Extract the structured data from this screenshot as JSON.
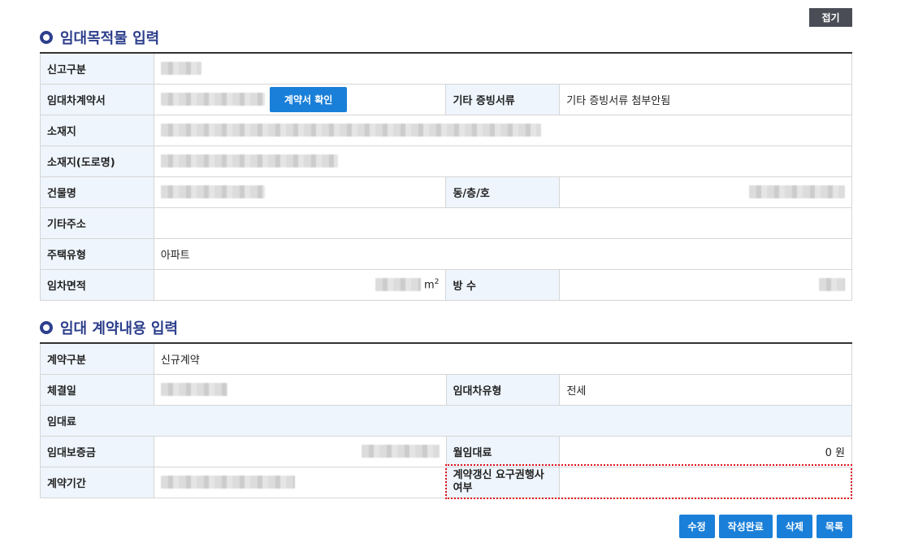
{
  "collapse_label": "접기",
  "section1": {
    "title": "임대목적물 입력",
    "report_type_label": "신고구분",
    "lease_contract_label": "임대차계약서",
    "contract_check_button": "계약서 확인",
    "other_docs_label": "기타 증빙서류",
    "other_docs_value": "기타 증빙서류 첨부안됨",
    "location_label": "소재지",
    "road_address_label": "소재지(도로명)",
    "building_name_label": "건물명",
    "dong_floor_ho_label": "동/층/호",
    "other_address_label": "기타주소",
    "housing_type_label": "주택유형",
    "housing_type_value": "아파트",
    "area_label": "임차면적",
    "area_unit": "m",
    "area_unit_sup": "2",
    "rooms_label": "방 수"
  },
  "section2": {
    "title": "임대 계약내용 입력",
    "contract_type_label": "계약구분",
    "contract_type_value": "신규계약",
    "sign_date_label": "체결일",
    "lease_type_label": "임대차유형",
    "lease_type_value": "전세",
    "rent_label": "임대료",
    "deposit_label": "임대보증금",
    "monthly_rent_label": "월임대료",
    "monthly_rent_value": "0 원",
    "period_label": "계약기간",
    "renewal_label_line1": "계약갱신 요구권행사",
    "renewal_label_line2": "여부"
  },
  "actions": {
    "edit": "수정",
    "complete": "작성완료",
    "delete": "삭제",
    "list": "목록"
  },
  "colors": {
    "accent": "#1a7fd8",
    "title": "#2d3f8c",
    "header_bg": "#eef5fc",
    "highlight_border": "#e0131c"
  }
}
